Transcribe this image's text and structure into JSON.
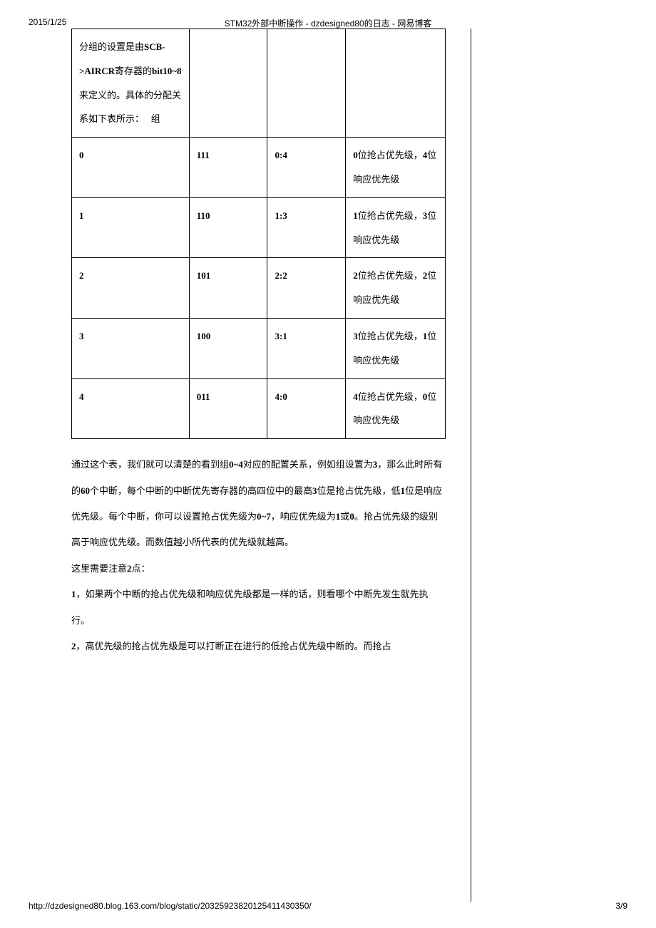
{
  "header": {
    "date": "2015/1/25",
    "title": "STM32外部中断操作 - dzdesigned80的日志 - 网易博客"
  },
  "footer": {
    "url": "http://dzdesigned80.blog.163.com/blog/static/20325923820125411430350/",
    "page": "3/9"
  },
  "table": {
    "intro_cell": "分组的设置是由SCB->AIRCR寄存器的bit10~8来定义的。具体的分配关系如下表所示：   组",
    "rows": [
      {
        "c0": "0",
        "c1": "111",
        "c2": "0:4",
        "c3": "0位抢占优先级，4位响应优先级"
      },
      {
        "c0": "1",
        "c1": "110",
        "c2": "1:3",
        "c3": "1位抢占优先级，3位响应优先级"
      },
      {
        "c0": "2",
        "c1": "101",
        "c2": "2:2",
        "c3": "2位抢占优先级，2位响应优先级"
      },
      {
        "c0": "3",
        "c1": "100",
        "c2": "3:1",
        "c3": "3位抢占优先级，1位响应优先级"
      },
      {
        "c0": "4",
        "c1": "011",
        "c2": "4:0",
        "c3": "4位抢占优先级，0位响应优先级"
      }
    ]
  },
  "paragraphs": {
    "p1": "通过这个表，我们就可以清楚的看到组0~4对应的配置关系，例如组设置为3，那么此时所有的60个中断，每个中断的中断优先寄存器的高四位中的最高3位是抢占优先级，低1位是响应优先级。每个中断，你可以设置抢占优先级为0~7，响应优先级为1或0。抢占优先级的级别高于响应优先级。而数值越小所代表的优先级就越高。",
    "p2": "这里需要注意2点：",
    "p3": "1，如果两个中断的抢占优先级和响应优先级都是一样的话，则看哪个中断先发生就先执行。",
    "p4": "2，高优先级的抢占优先级是可以打断正在进行的低抢占优先级中断的。而抢占"
  }
}
